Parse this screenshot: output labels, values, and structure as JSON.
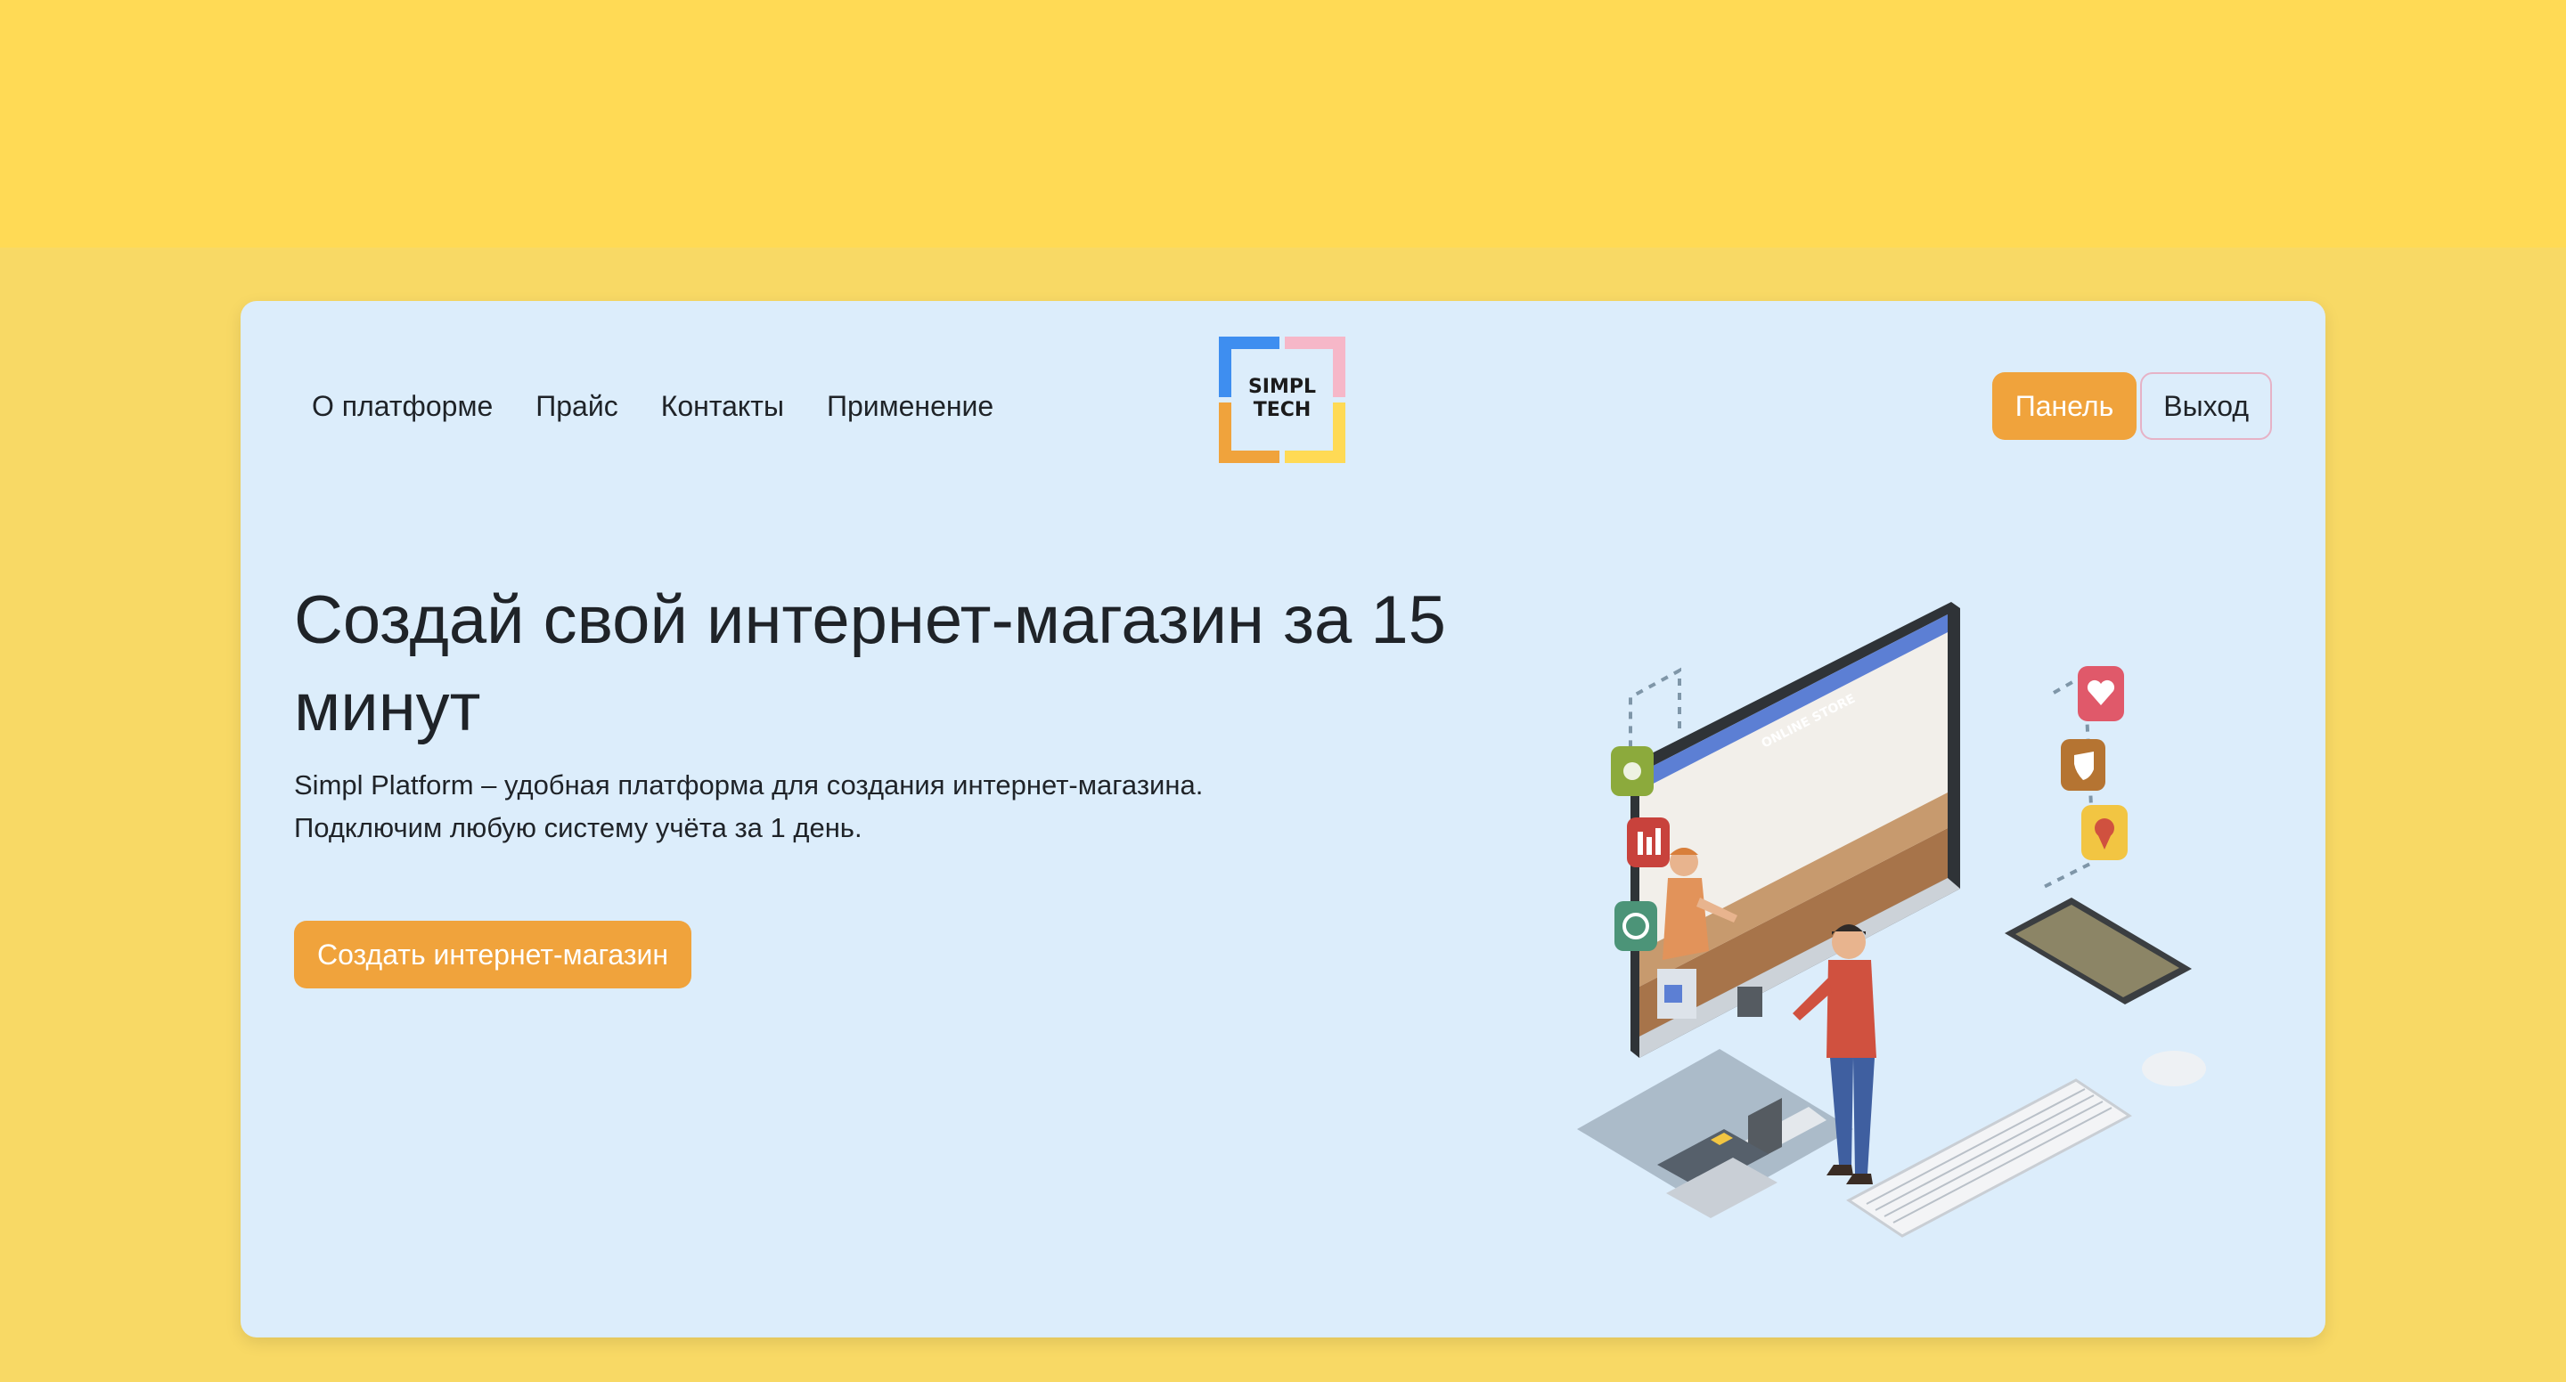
{
  "nav": {
    "items": [
      {
        "label": "О платформе"
      },
      {
        "label": "Прайс"
      },
      {
        "label": "Контакты"
      },
      {
        "label": "Применение"
      }
    ]
  },
  "logo": {
    "line1": "SIMPL",
    "line2": "TECH"
  },
  "header_actions": {
    "panel_label": "Панель",
    "exit_label": "Выход"
  },
  "hero": {
    "title": "Создай свой интернет-магазин за 15 минут",
    "description_line1": "Simpl Platform – удобная платформа для создания интернет-магазина.",
    "description_line2": "Подключим любую систему учёта за 1 день.",
    "cta_label": "Создать интернет-магазин"
  },
  "illustration": {
    "screen_label": "ONLINE STORE"
  },
  "colors": {
    "page_background": "#F8D965",
    "top_band": "#FFDA55",
    "card_background": "#DCEDFB",
    "accent": "#F0A33C",
    "text": "#1F2328"
  }
}
